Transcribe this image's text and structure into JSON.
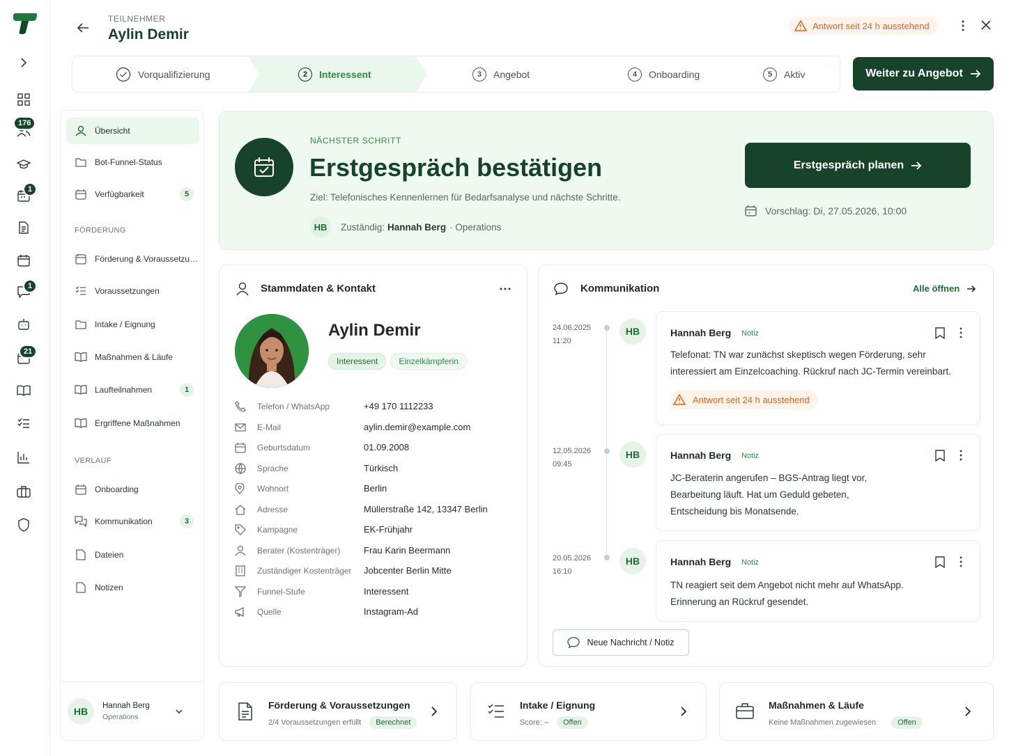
{
  "header": {
    "eyebrow": "TEILNEHMER",
    "name": "Aylin Demir",
    "warning": "Antwort seit 24 h ausstehend"
  },
  "rail": {
    "badges": [
      "176",
      "1",
      "1",
      "21"
    ]
  },
  "stepper": {
    "steps": [
      {
        "num": "",
        "label": "Vorqualifizierung",
        "state": "done"
      },
      {
        "num": "2",
        "label": "Interessent",
        "state": "active"
      },
      {
        "num": "3",
        "label": "Angebot",
        "state": "todo"
      },
      {
        "num": "4",
        "label": "Onboarding",
        "state": "todo"
      },
      {
        "num": "5",
        "label": "Aktiv",
        "state": "todo"
      }
    ],
    "cta": "Weiter zu Angebot"
  },
  "sidebar": {
    "items": [
      {
        "label": "Übersicht",
        "count": ""
      },
      {
        "label": "Bot-Funnel-Status",
        "count": ""
      },
      {
        "label": "Verfügbarkeit",
        "count": "5"
      }
    ],
    "section_foerderung": "FÖRDERUNG",
    "foerderung_items": [
      {
        "label": "Förderung & Voraussetzun...",
        "count": ""
      },
      {
        "label": "Voraussetzungen",
        "count": ""
      },
      {
        "label": "Intake / Eignung",
        "count": ""
      },
      {
        "label": "Maßnahmen & Läufe",
        "count": ""
      },
      {
        "label": "Laufteilnahmen",
        "count": "1"
      },
      {
        "label": "Ergriffene Maßnahmen",
        "count": ""
      }
    ],
    "section_verlauf": "VERLAUF",
    "verlauf_items": [
      {
        "label": "Onboarding",
        "count": ""
      },
      {
        "label": "Kommunikation",
        "count": "3"
      },
      {
        "label": "Dateien",
        "count": ""
      },
      {
        "label": "Notizen",
        "count": ""
      }
    ],
    "user": {
      "initials": "HB",
      "name": "Hannah Berg",
      "role": "Operations"
    }
  },
  "next_step": {
    "eyebrow": "NÄCHSTER SCHRITT",
    "title": "Erstgespräch bestätigen",
    "goal": "Ziel: Telefonisches Kennenlernen für Bedarfsanalyse und nächste Schritte.",
    "owner_initials": "HB",
    "owner_prefix": "Zuständig:",
    "owner_name": "Hannah Berg",
    "owner_team": "· Operations",
    "button": "Erstgespräch planen",
    "suggestion": "Vorschlag: Di, 27.05.2026, 10:00"
  },
  "stammdaten": {
    "title": "Stammdaten & Kontakt",
    "name": "Aylin Demir",
    "tags": [
      "Interessent",
      "Einzelkämpferin"
    ],
    "fields": [
      {
        "icon": "phone-icon",
        "label": "Telefon / WhatsApp",
        "value": "+49 170 1112233"
      },
      {
        "icon": "mail-icon",
        "label": "E-Mail",
        "value": "aylin.demir@example.com"
      },
      {
        "icon": "calendar-icon",
        "label": "Geburtsdatum",
        "value": "01.09.2008"
      },
      {
        "icon": "globe-icon",
        "label": "Sprache",
        "value": "Türkisch"
      },
      {
        "icon": "pin-icon",
        "label": "Wohnort",
        "value": "Berlin"
      },
      {
        "icon": "home-icon",
        "label": "Adresse",
        "value": "Müllerstraße 142, 13347 Berlin"
      },
      {
        "icon": "tag-icon",
        "label": "Kampagne",
        "value": "EK-Frühjahr"
      },
      {
        "icon": "user-icon",
        "label": "Berater (Kostenträger)",
        "value": "Frau Karin Beermann"
      },
      {
        "icon": "building-icon",
        "label": "Zuständiger Kostenträger",
        "value": "Jobcenter Berlin Mitte"
      },
      {
        "icon": "funnel-icon",
        "label": "Funnel-Stufe",
        "value": "Interessent"
      },
      {
        "icon": "megaphone-icon",
        "label": "Quelle",
        "value": "Instagram-Ad"
      }
    ]
  },
  "kommunikation": {
    "title": "Kommunikation",
    "open_all": "Alle öffnen",
    "new_button": "Neue Nachricht / Notiz",
    "messages": [
      {
        "date": "24.06.2025",
        "time": "11:20",
        "initials": "HB",
        "author": "Hannah Berg",
        "tag": "Notiz",
        "lines": [
          "Telefonat: TN war zunächst skeptisch wegen Förderung, sehr",
          "interessiert am Einzelcoaching. Rückruf nach JC-Termin vereinbart."
        ],
        "warning": "Antwort seit 24 h ausstehend"
      },
      {
        "date": "12.05.2026",
        "time": "09:45",
        "initials": "HB",
        "author": "Hannah Berg",
        "tag": "Notiz",
        "lines": [
          "JC-Beraterin angerufen – BGS-Antrag liegt vor,",
          "Bearbeitung läuft. Hat um Geduld gebeten,",
          "Entscheidung bis Monatsende."
        ],
        "warning": ""
      },
      {
        "date": "20.05.2026",
        "time": "16:10",
        "initials": "HB",
        "author": "Hannah Berg",
        "tag": "Notiz",
        "lines": [
          "TN reagiert seit dem Angebot nicht mehr auf WhatsApp.",
          "Erinnerung an Rückruf gesendet."
        ],
        "warning": ""
      }
    ]
  },
  "bottom_cards": [
    {
      "title": "Förderung & Voraussetzungen",
      "sub": "2/4 Voraussetzungen erfüllt",
      "pill": "Berechnet"
    },
    {
      "title": "Intake / Eignung",
      "sub": "Score: –",
      "pill": "Offen"
    },
    {
      "title": "Maßnahmen & Läufe",
      "sub": "Keine Maßnahmen zugewiesen",
      "pill": "Offen"
    }
  ],
  "colors": {
    "brand": "#16432a",
    "accent": "#2f8a47",
    "warning": "#e0621c",
    "highlight": "#eaf7ec"
  }
}
